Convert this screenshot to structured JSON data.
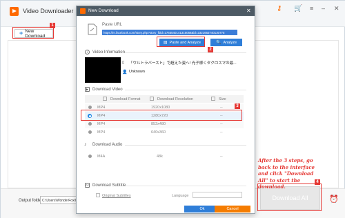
{
  "app": {
    "title": "Video Downloader",
    "new_download_label": "New Download",
    "output_label": "Output folder:",
    "output_path": "C:\\Users\\WonderFox\\Docum",
    "download_all_label": "Download All"
  },
  "dialog": {
    "title": "New Download",
    "paste_url_label": "Paste URL",
    "url_value": "https://m.facebook.com/story.php?story_fbid=1765540141315058&id=2321663740130775",
    "paste_analyze_label": "Paste and Analyze",
    "analyze_label": "Analyze",
    "video_info_label": "Video Information",
    "video_title": "「ウルトラバースト」で超えた姿へ! 光子様くタクロスマの最...",
    "video_author": "Unknown",
    "download_video_label": "Download Video",
    "columns": {
      "format": "Download Format",
      "resolution": "Download Resolution",
      "size": "Size"
    },
    "video_rows": [
      {
        "format": "MP4",
        "resolution": "1920x1080",
        "size": "--"
      },
      {
        "format": "MP4",
        "resolution": "1280x720",
        "size": "--"
      },
      {
        "format": "MP4",
        "resolution": "852x480",
        "size": "--"
      },
      {
        "format": "MP4",
        "resolution": "640x360",
        "size": "--"
      }
    ],
    "download_audio_label": "Download Audio",
    "audio_rows": [
      {
        "format": "M4A",
        "bitrate": "48k",
        "size": "--"
      }
    ],
    "download_subtitle_label": "Download Subtitle",
    "original_subtitles_label": "Original Subtitles",
    "language_label": "Language",
    "ok_label": "Ok",
    "cancel_label": "Cancel"
  },
  "annotations": {
    "steps": [
      "1",
      "2",
      "3",
      "4"
    ],
    "note": "After the 3 steps, go back to the interface and click \"Download All\" to start the download."
  },
  "colors": {
    "accent": "#2f7ed8",
    "cancel": "#f57c00",
    "annotation": "#e53935",
    "dialog_titlebar": "#4d5a64"
  }
}
